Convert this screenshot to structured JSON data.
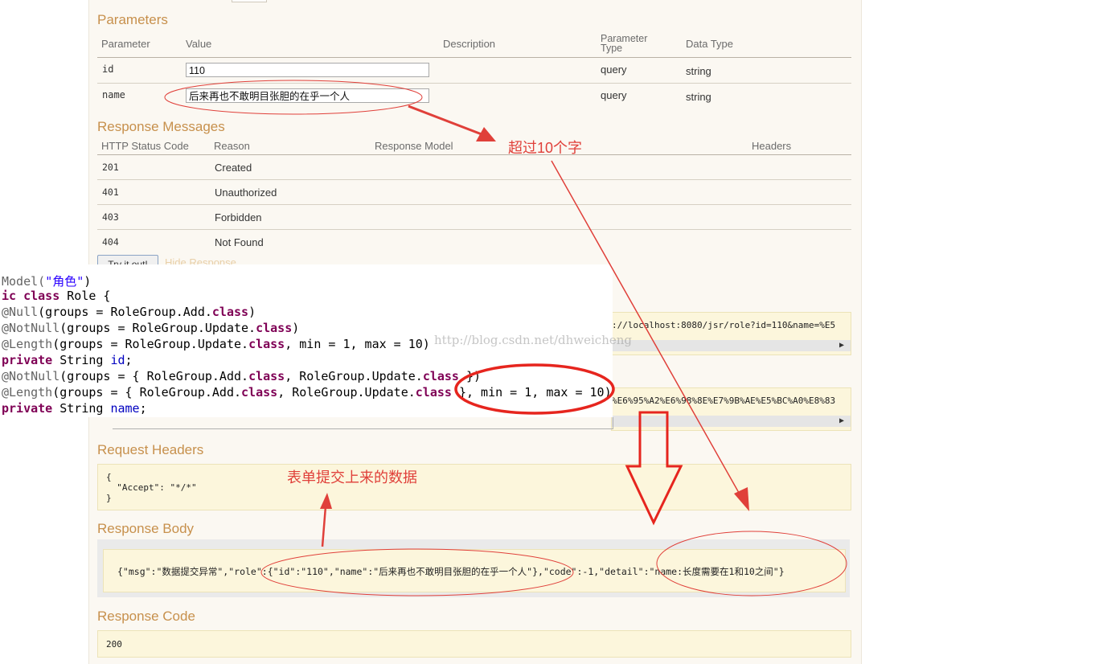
{
  "parameters": {
    "title": "Parameters",
    "headers": {
      "parameter": "Parameter",
      "value": "Value",
      "description": "Description",
      "param_type_1": "Parameter",
      "param_type_2": "Type",
      "data_type": "Data Type"
    },
    "rows": [
      {
        "name": "id",
        "value": "110",
        "param_type": "query",
        "data_type": "string"
      },
      {
        "name": "name",
        "value": "后来再也不敢明目张胆的在乎一个人",
        "param_type": "query",
        "data_type": "string"
      }
    ]
  },
  "response_messages": {
    "title": "Response Messages",
    "headers": {
      "code": "HTTP Status Code",
      "reason": "Reason",
      "model": "Response Model",
      "headers": "Headers"
    },
    "rows": [
      {
        "code": "201",
        "reason": "Created"
      },
      {
        "code": "401",
        "reason": "Unauthorized"
      },
      {
        "code": "403",
        "reason": "Forbidden"
      },
      {
        "code": "404",
        "reason": "Not Found"
      }
    ]
  },
  "actions": {
    "try_it_out": "Try it out!",
    "hide_response": "Hide Response"
  },
  "code_snippet": {
    "lines": [
      {
        "parts": [
          {
            "t": "Model(",
            "c": "ann"
          },
          {
            "t": "\"角色\"",
            "c": "str"
          },
          {
            "t": ")",
            "c": ""
          }
        ]
      },
      {
        "parts": [
          {
            "t": "ic ",
            "c": "kw"
          },
          {
            "t": "class",
            "c": "kw"
          },
          {
            "t": " Role {",
            "c": ""
          }
        ]
      },
      {
        "parts": [
          {
            "t": "@Null",
            "c": "ann"
          },
          {
            "t": "(groups = RoleGroup.Add.",
            "c": ""
          },
          {
            "t": "class",
            "c": "kw"
          },
          {
            "t": ")",
            "c": ""
          }
        ]
      },
      {
        "parts": [
          {
            "t": "@NotNull",
            "c": "ann"
          },
          {
            "t": "(groups = RoleGroup.Update.",
            "c": ""
          },
          {
            "t": "class",
            "c": "kw"
          },
          {
            "t": ")",
            "c": ""
          }
        ]
      },
      {
        "parts": [
          {
            "t": "@Length",
            "c": "ann"
          },
          {
            "t": "(groups = RoleGroup.Update.",
            "c": ""
          },
          {
            "t": "class",
            "c": "kw"
          },
          {
            "t": ", min = 1, max = 10)",
            "c": ""
          }
        ]
      },
      {
        "parts": [
          {
            "t": "private",
            "c": "kw"
          },
          {
            "t": " String ",
            "c": ""
          },
          {
            "t": "id",
            "c": "fld"
          },
          {
            "t": ";",
            "c": ""
          }
        ]
      },
      {
        "parts": [
          {
            "t": "@NotNull",
            "c": "ann"
          },
          {
            "t": "(groups = { RoleGroup.Add.",
            "c": ""
          },
          {
            "t": "class",
            "c": "kw"
          },
          {
            "t": ", RoleGroup.Update.",
            "c": ""
          },
          {
            "t": "class",
            "c": "kw"
          },
          {
            "t": " })",
            "c": ""
          }
        ]
      },
      {
        "parts": [
          {
            "t": "@Length",
            "c": "ann"
          },
          {
            "t": "(groups = { RoleGroup.Add.",
            "c": ""
          },
          {
            "t": "class",
            "c": "kw"
          },
          {
            "t": ", RoleGroup.Update.",
            "c": ""
          },
          {
            "t": "class",
            "c": "kw"
          },
          {
            "t": " }, min = 1, max = 10)",
            "c": ""
          }
        ]
      },
      {
        "parts": [
          {
            "t": "private",
            "c": "kw"
          },
          {
            "t": " String ",
            "c": ""
          },
          {
            "t": "name",
            "c": "fld"
          },
          {
            "t": ";",
            "c": ""
          }
        ]
      }
    ]
  },
  "request_url": {
    "visible": "://localhost:8080/jsr/role?id=110&name=%E5"
  },
  "curl_url": {
    "visible": "%E6%95%A2%E6%98%8E%E7%9B%AE%E5%BC%A0%E8%83"
  },
  "watermark": "http://blog.csdn.net/dhweicheng",
  "request_headers": {
    "title": "Request Headers",
    "line1": "{",
    "line2": "  \"Accept\": \"*/*\"",
    "line3": "}"
  },
  "response_body": {
    "title": "Response Body",
    "text": "{\"msg\":\"数据提交异常\",\"role\":{\"id\":\"110\",\"name\":\"后来再也不敢明目张胆的在乎一个人\"},\"code\":-1,\"detail\":\"name:长度需要在1和10之间\"}"
  },
  "response_code": {
    "title": "Response Code",
    "value": "200"
  },
  "annotations": {
    "over_limit": "超过10个字",
    "form_data": "表单提交上来的数据",
    "color": "#e0403a"
  }
}
